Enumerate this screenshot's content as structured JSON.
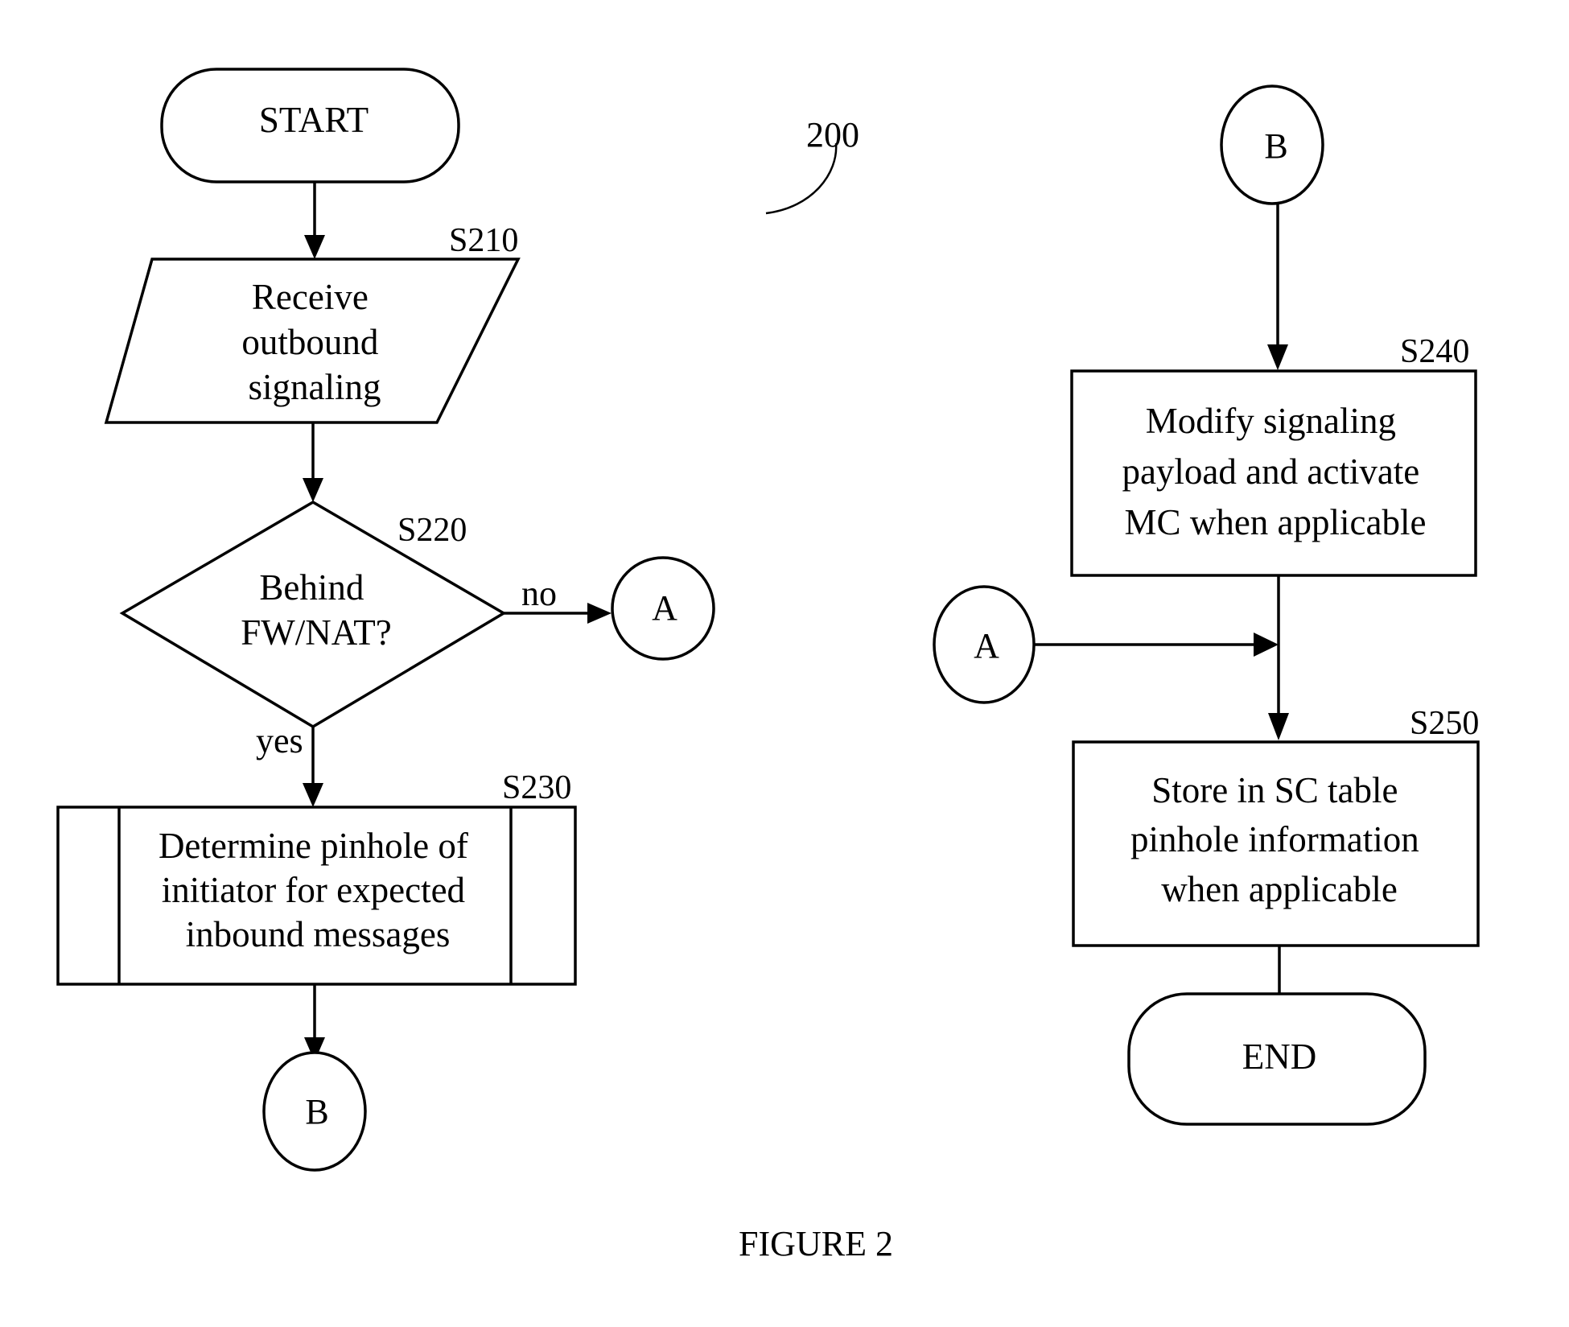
{
  "figure": {
    "reference_number": "200",
    "caption": "FIGURE 2"
  },
  "nodes": {
    "start": {
      "label": "START"
    },
    "s210": {
      "step": "S210",
      "lines": [
        "Receive",
        "outbound",
        "signaling"
      ]
    },
    "s220": {
      "step": "S220",
      "lines": [
        "Behind",
        "FW/NAT?"
      ]
    },
    "s230": {
      "step": "S230",
      "lines": [
        "Determine pinhole of",
        "initiator for expected",
        "inbound messages"
      ]
    },
    "connector_a_left": {
      "label": "A"
    },
    "connector_b_left": {
      "label": "B"
    },
    "connector_b_right": {
      "label": "B"
    },
    "s240": {
      "step": "S240",
      "lines": [
        "Modify signaling",
        "payload and activate",
        "MC when applicable"
      ]
    },
    "connector_a_right": {
      "label": "A"
    },
    "s250": {
      "step": "S250",
      "lines": [
        "Store in SC table",
        "pinhole information",
        "when applicable"
      ]
    },
    "end": {
      "label": "END"
    }
  },
  "edges": {
    "no_label": "no",
    "yes_label": "yes"
  }
}
